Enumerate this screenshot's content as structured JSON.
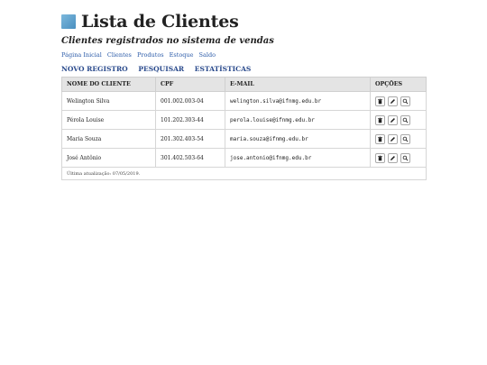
{
  "header": {
    "title": "Lista de Clientes",
    "subtitle": "Clientes registrados no sistema de vendas"
  },
  "nav": [
    "Página Inicial",
    "Clientes",
    "Produtos",
    "Estoque",
    "Saldo"
  ],
  "actions": [
    "NOVO REGISTRO",
    "PESQUISAR",
    "ESTATÍSTICAS"
  ],
  "table": {
    "columns": [
      "NOME DO CLIENTE",
      "CPF",
      "E-MAIL",
      "OPÇÕES"
    ],
    "rows": [
      {
        "name": "Welington Silva",
        "cpf": "001.002.003-04",
        "email": "welington.silva@ifnmg.edu.br"
      },
      {
        "name": "Pérola Louise",
        "cpf": "101.202.303-44",
        "email": "perola.louise@ifnmg.edu.br"
      },
      {
        "name": "Maria Souza",
        "cpf": "201.302.403-54",
        "email": "maria.souza@ifnmg.edu.br"
      },
      {
        "name": "José Antônio",
        "cpf": "301.402.503-64",
        "email": "jose.antonio@ifnmg.edu.br"
      }
    ],
    "row_buttons": [
      "trash-icon",
      "pencil-icon",
      "search-icon"
    ],
    "footer": "Última atualização: 07/05/2019."
  },
  "colors": {
    "logo": "#5b9fcf",
    "link": "#2a5aa8",
    "header_bg": "#e4e4e4"
  }
}
